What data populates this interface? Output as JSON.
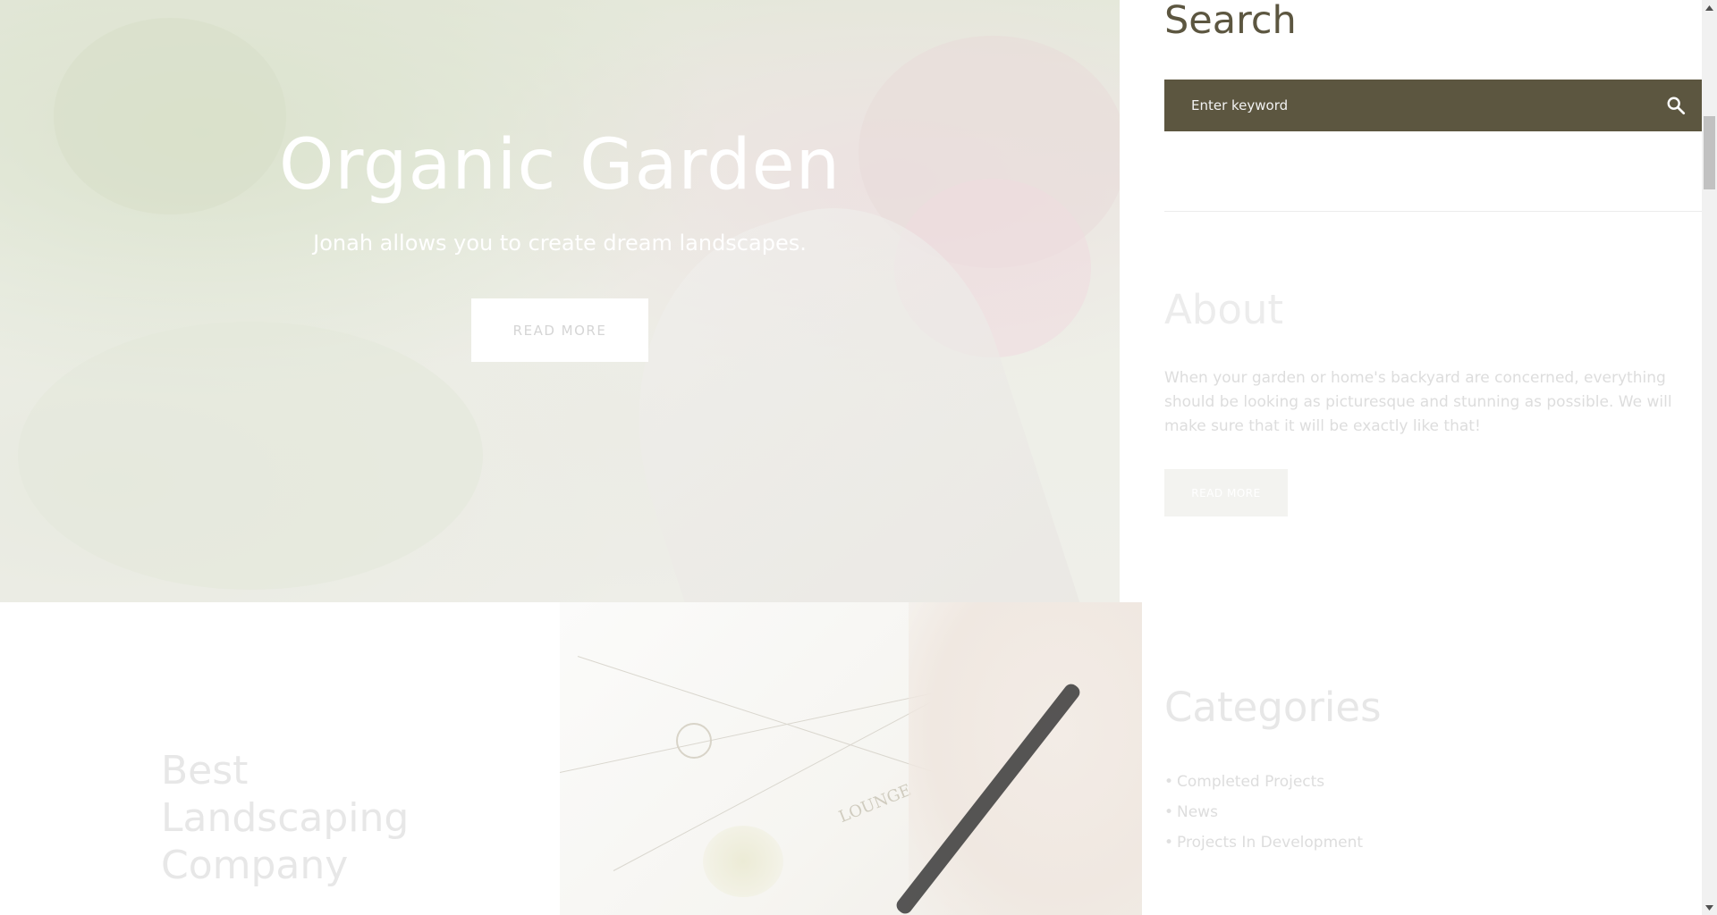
{
  "hero": {
    "title": "Organic Garden",
    "subtitle": "Jonah allows you to create dream landscapes.",
    "button_label": "READ MORE"
  },
  "sidebar": {
    "search": {
      "title": "Search",
      "placeholder": "Enter keyword",
      "button_icon": "search-icon"
    },
    "about": {
      "title": "About",
      "text": "When your garden or home's backyard are concerned, everything should be looking as picturesque and stunning as possible. We will make sure that it will be exactly like that!",
      "button_label": "READ MORE"
    },
    "categories": {
      "title": "Categories",
      "items": [
        "Completed Projects",
        "News",
        "Projects In Development"
      ]
    }
  },
  "promo": {
    "title_lines": [
      "Best",
      "Landscaping",
      "Company"
    ]
  },
  "blueprint_image": {
    "label_text": "LOUNGE"
  },
  "colors": {
    "accent": "#5c5640",
    "faded_text": "#e7e7e7",
    "white": "#ffffff"
  }
}
